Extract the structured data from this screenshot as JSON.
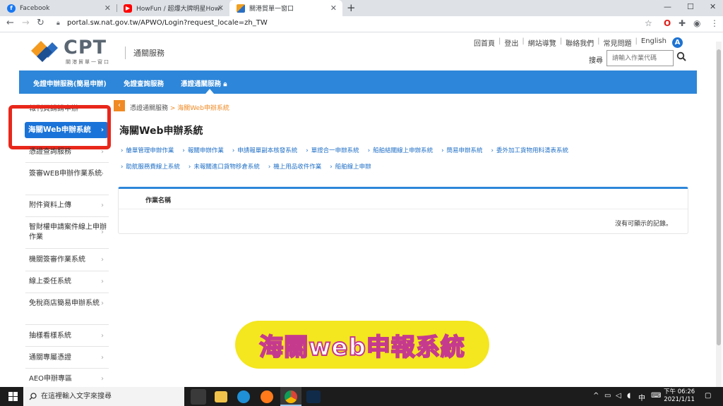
{
  "browser": {
    "tabs": [
      {
        "title": "Facebook",
        "icon": "facebook-icon",
        "active": false
      },
      {
        "title": "HowFun / 超爆大牌明星How哥",
        "icon": "youtube-icon",
        "active": false
      },
      {
        "title": "關港貿單一窗口",
        "icon": "site-icon",
        "active": true
      }
    ],
    "new_tab": "+",
    "url": "portal.sw.nat.gov.tw/APWO/Login?request_locale=zh_TW",
    "window_controls": [
      "—",
      "☐",
      "✕"
    ]
  },
  "header": {
    "logo_text": "CPT",
    "logo_sub": "關港貿單一窗口",
    "section_title": "通關服務",
    "top_links": [
      "回首頁",
      "登出",
      "網站導覽",
      "聯絡我們",
      "常見問題",
      "English"
    ],
    "avatar_letter": "A",
    "search_label": "搜尋",
    "search_placeholder": "請輸入作業代碼"
  },
  "nav": {
    "items": [
      "免證申辦服務(簡易申辦)",
      "免證查詢服務",
      "憑證通關服務"
    ],
    "lock": "🔒"
  },
  "sidebar": {
    "partial_top": "報刊頁請請申辦",
    "active_item": "海關Web申辦系統",
    "items": [
      "憑證查詢服務",
      "簽審WEB申辦作業系統",
      "附件資料上傳",
      "智財權申請案件線上申辦作業",
      "機關簽審作業系統",
      "線上委任系統",
      "免稅商店簡易申辦系統",
      "抽樣看樣系統",
      "通關專屬憑證",
      "AEO申辦專區"
    ],
    "chevron": "›"
  },
  "main": {
    "breadcrumb_root": "憑證通關服務",
    "breadcrumb_sep": " > ",
    "breadcrumb_current": "海關Web申辦系統",
    "title": "海關Web申辦系統",
    "links_row1": [
      "艙單管理申辦作業",
      "報關申辦作業",
      "申請報單副本核發系統",
      "單證合一申辦系統",
      "船舶結關線上申辦系統",
      "簡易申辦系統",
      "委外加工貨物用料清表系統"
    ],
    "links_row2": [
      "助航服務費線上系統",
      "未報關進口貨物移倉系統",
      "機上用品收件作業",
      "船舶線上申辦"
    ],
    "table_header": "作業名稱",
    "empty_message": "沒有可顯示的記錄。"
  },
  "caption": "海關web申報系統",
  "taskbar": {
    "search_placeholder": "在這裡輸入文字來搜尋",
    "time": "下午 06:26",
    "date": "2021/1/11"
  },
  "colors": {
    "nav_blue": "#2d86d9",
    "active_blue": "#1a73d8",
    "accent_orange": "#f08a24",
    "highlight_red": "#e8271a",
    "caption_yellow": "#f4e61f"
  }
}
